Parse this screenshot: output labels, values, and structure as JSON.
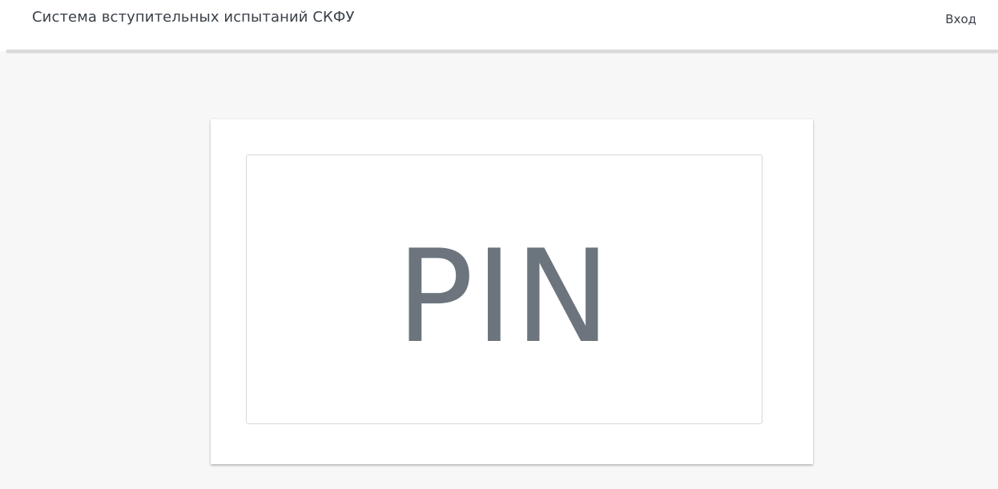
{
  "header": {
    "title": "Система вступительных испытаний СКФУ",
    "login_label": "Вход"
  },
  "main": {
    "pin_placeholder": "PIN"
  },
  "colors": {
    "background": "#f7f7f7",
    "card": "#ffffff",
    "pin_text": "#6c757d",
    "header_text": "#3a4048"
  }
}
